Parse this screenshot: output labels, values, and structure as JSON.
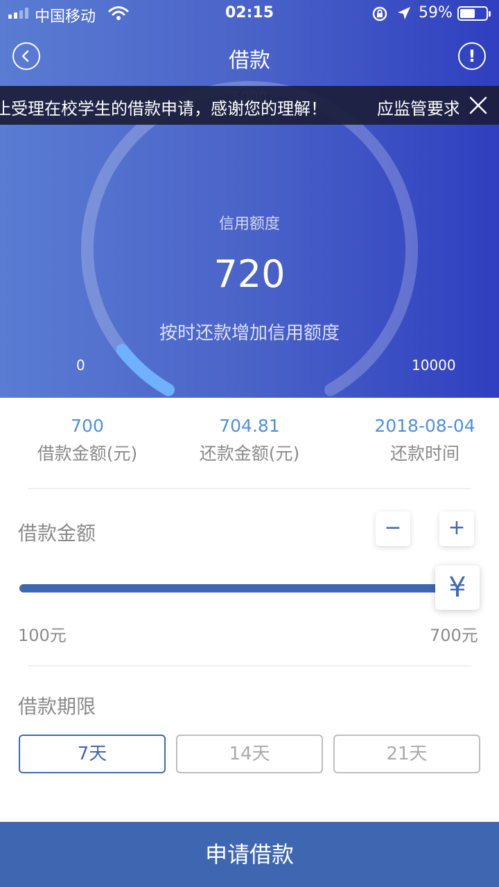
{
  "status_bar": {
    "carrier": "中国移动",
    "time": "02:15",
    "battery_percent": "59%",
    "battery_level": 0.59,
    "signal_bars_filled": 2,
    "signal_bars_total": 4
  },
  "nav": {
    "title": "借款",
    "back_icon": "chevron-left-icon",
    "info_label": "!"
  },
  "notice": {
    "text": "止受理在校学生的借款申请，感谢您的理解！",
    "text_next": "应监管要求",
    "close_icon": "close-icon",
    "gauge_peek": "5000"
  },
  "gauge": {
    "title": "信用额度",
    "value": "720",
    "subtitle": "按时还款增加信用额度",
    "min_label": "0",
    "max_label": "10000",
    "min": 0,
    "max": 10000,
    "current": 720
  },
  "summary": {
    "loan_amount": {
      "value": "700",
      "label": "借款金额(元)"
    },
    "repay_amount": {
      "value": "704.81",
      "label": "还款金额(元)"
    },
    "repay_date": {
      "value": "2018-08-04",
      "label": "还款时间"
    }
  },
  "loan": {
    "title": "借款金额",
    "minus": "−",
    "plus": "+",
    "thumb_symbol": "¥",
    "min_label": "100元",
    "max_label": "700元",
    "slider_fraction": 1.0
  },
  "term": {
    "title": "借款期限",
    "options": [
      "7天",
      "14天",
      "21天"
    ],
    "selected": "7天"
  },
  "apply": {
    "label": "申请借款"
  },
  "colors": {
    "accent": "#3f67b1",
    "value_blue": "#4a90e2",
    "muted_text": "#8a8a8a",
    "hero_start": "#5a7cd3",
    "hero_end": "#2f3fc0"
  }
}
